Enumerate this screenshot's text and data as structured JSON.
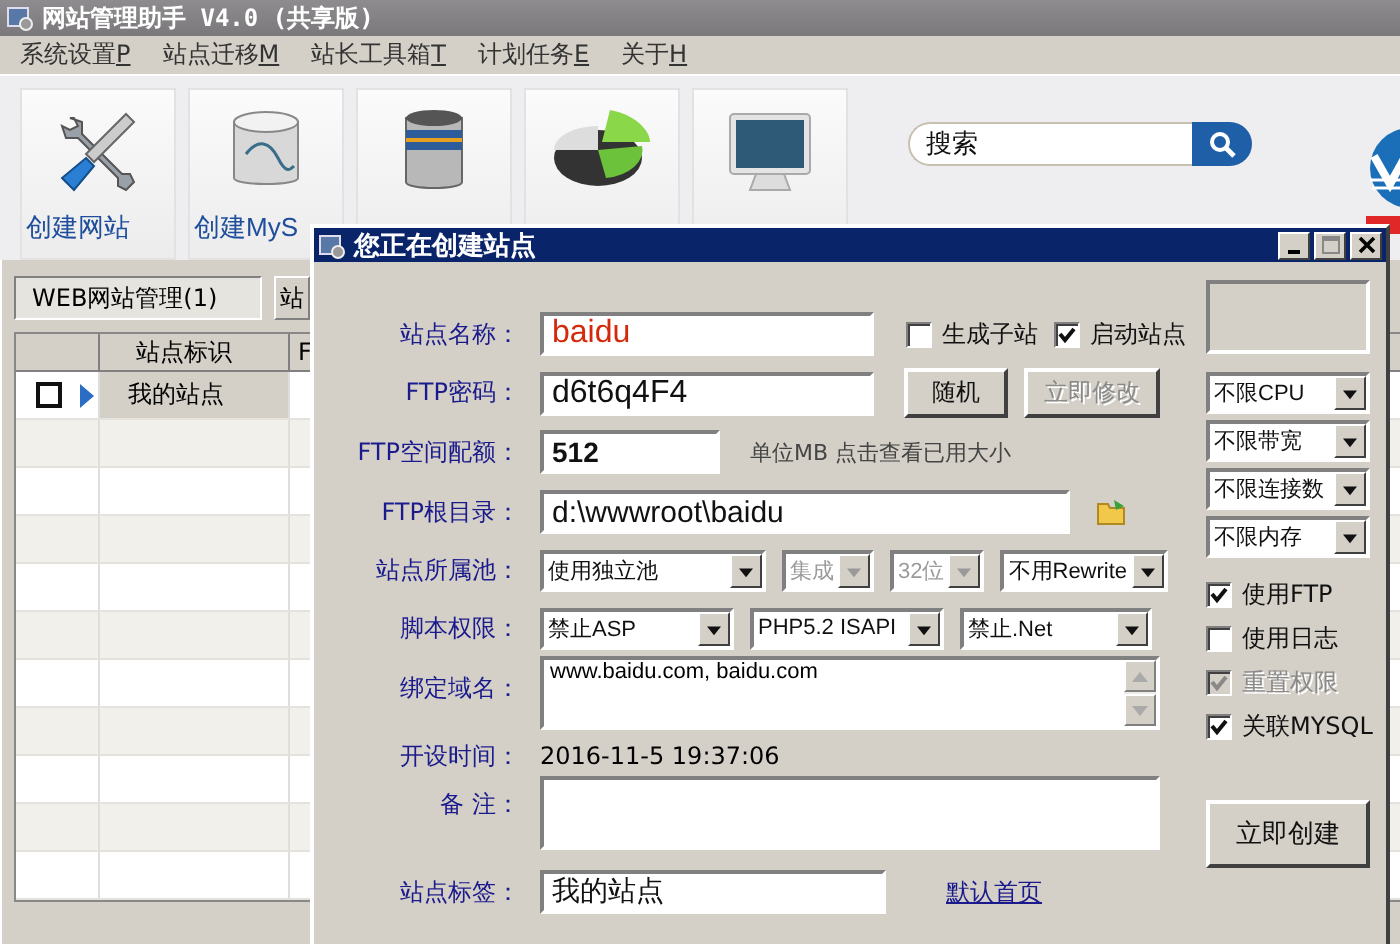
{
  "window": {
    "title": "网站管理助手 V4.0 (共享版)"
  },
  "menu": [
    {
      "label": "系统设置",
      "key": "P"
    },
    {
      "label": "站点迁移",
      "key": "M"
    },
    {
      "label": "站长工具箱",
      "key": "T"
    },
    {
      "label": "计划任务",
      "key": "E"
    },
    {
      "label": "关于",
      "key": "H"
    }
  ],
  "toolbar": [
    {
      "kind": "tools",
      "label": "创建网站"
    },
    {
      "kind": "mysql",
      "label": "创建MyS"
    },
    {
      "kind": "database"
    },
    {
      "kind": "chart"
    },
    {
      "kind": "monitor"
    }
  ],
  "search": {
    "placeholder": "搜索"
  },
  "tabs": [
    {
      "label": "WEB网站管理(1)",
      "selected": true
    },
    {
      "label": "站",
      "selected": false
    }
  ],
  "table": {
    "columns": [
      "站点标识",
      "F"
    ],
    "rows": [
      {
        "checked": false,
        "selected": true,
        "cells": [
          "我的站点"
        ]
      }
    ]
  },
  "dialog": {
    "title": "您正在创建站点",
    "site_name": {
      "label": "站点名称：",
      "value": "baidu"
    },
    "flags": [
      {
        "label": "生成子站",
        "checked": false
      },
      {
        "label": "启动站点",
        "checked": true
      }
    ],
    "ftp_password": {
      "label": "FTP密码：",
      "value": "d6t6q4F4"
    },
    "random_button": {
      "label": "随机",
      "disabled": false
    },
    "modify_button": {
      "label": "立即修改",
      "disabled": true
    },
    "ftp_quota": {
      "label": "FTP空间配额：",
      "value": "512",
      "hint": "单位MB 点击查看已用大小"
    },
    "ftp_root": {
      "label": "FTP根目录：",
      "value": "d:\\wwwroot\\baidu"
    },
    "pool": {
      "label": "站点所属池：",
      "selects": [
        {
          "value": "使用独立池",
          "disabled": false
        },
        {
          "value": "集成",
          "disabled": true
        },
        {
          "value": "32位",
          "disabled": true
        },
        {
          "value": "不用Rewrite",
          "disabled": false
        }
      ]
    },
    "script": {
      "label": "脚本权限：",
      "selects": [
        {
          "value": "禁止ASP",
          "disabled": false
        },
        {
          "value": "PHP5.2 ISAPI",
          "disabled": false
        },
        {
          "value": "禁止.Net",
          "disabled": false
        }
      ]
    },
    "domains": {
      "label": "绑定域名：",
      "value": "www.baidu.com, baidu.com"
    },
    "created": {
      "label": "开设时间：",
      "value": "2016-11-5 19:37:06"
    },
    "note": {
      "label": "备 注："
    },
    "tag": {
      "label": "站点标签：",
      "value": "我的站点"
    },
    "default_page_link": "默认首页",
    "limits": [
      {
        "value": "不限CPU"
      },
      {
        "value": "不限带宽"
      },
      {
        "value": "不限连接数"
      },
      {
        "value": "不限内存"
      }
    ],
    "options": [
      {
        "label": "使用FTP",
        "checked": true,
        "disabled": false
      },
      {
        "label": "使用日志",
        "checked": false,
        "disabled": false
      },
      {
        "label": "重置权限",
        "checked": true,
        "disabled": true
      },
      {
        "label": "关联MYSQL",
        "checked": true,
        "disabled": false
      }
    ],
    "create_button": "立即创建"
  }
}
